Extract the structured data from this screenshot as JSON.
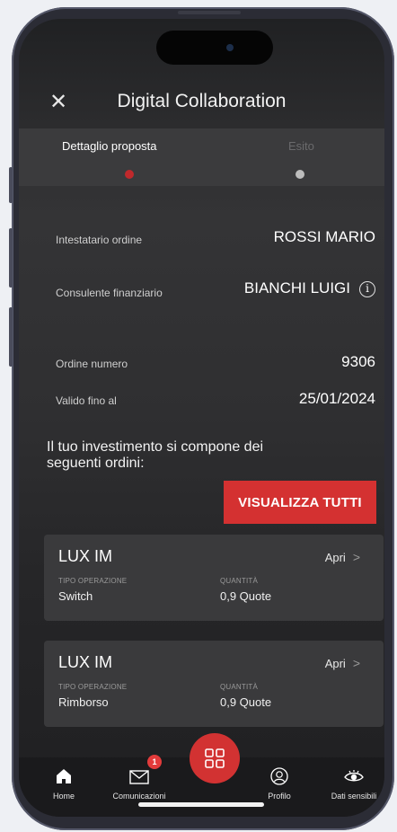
{
  "header": {
    "title": "Digital Collaboration",
    "close_icon": "close-icon"
  },
  "steps": [
    {
      "label": "Dettaglio proposta",
      "state": "active",
      "color": "#c0292c"
    },
    {
      "label": "Esito",
      "state": "inactive",
      "color": "#bdbdbd"
    }
  ],
  "details": [
    {
      "label": "Intestatario ordine",
      "value": "ROSSI MARIO"
    },
    {
      "label": "Consulente finanziario",
      "value": "BIANCHI LUIGI",
      "icon": "info-icon",
      "icon_glyph": "i"
    },
    {
      "label": "Ordine numero",
      "value": "9306"
    },
    {
      "label": "Valido fino al",
      "value": "25/01/2024"
    }
  ],
  "intro_text": "Il tuo investimento si compone dei seguenti ordini:",
  "view_all_label": "VISUALIZZA TUTTI",
  "orders": [
    {
      "name": "LUX IM",
      "open_label": "Apri",
      "type_label": "TIPO OPERAZIONE",
      "type_value": "Switch",
      "qty_label": "QUANTITÀ",
      "qty_value": "0,9 Quote"
    },
    {
      "name": "LUX IM",
      "open_label": "Apri",
      "type_label": "TIPO OPERAZIONE",
      "type_value": "Rimborso",
      "qty_label": "QUANTITÀ",
      "qty_value": "0,9 Quote"
    }
  ],
  "tabbar": {
    "items": [
      {
        "label": "Home",
        "icon": "home-icon"
      },
      {
        "label": "Comunicazioni",
        "icon": "envelope-icon",
        "badge": "1"
      },
      {
        "label": "Profilo",
        "icon": "profile-icon"
      },
      {
        "label": "Dati sensibili",
        "icon": "eye-icon"
      }
    ],
    "center_icon": "grid-icon"
  },
  "colors": {
    "accent": "#d43131",
    "background": "#2e2e30",
    "card": "#3a3a3c"
  }
}
